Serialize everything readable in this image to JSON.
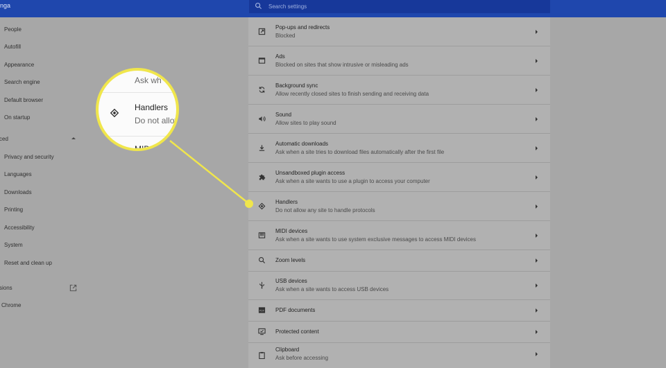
{
  "header": {
    "app_title": "nga",
    "search_placeholder": "Search settings"
  },
  "sidebar": {
    "items": [
      {
        "label": "People"
      },
      {
        "label": "Autofill"
      },
      {
        "label": "Appearance"
      },
      {
        "label": "Search engine"
      },
      {
        "label": "Default browser"
      },
      {
        "label": "On startup"
      }
    ],
    "advanced_label": "ced",
    "advanced_items": [
      {
        "label": "Privacy and security"
      },
      {
        "label": "Languages"
      },
      {
        "label": "Downloads"
      },
      {
        "label": "Printing"
      },
      {
        "label": "Accessibility"
      },
      {
        "label": "System"
      },
      {
        "label": "Reset and clean up"
      }
    ],
    "extensions_label": "sions",
    "about_label": "Chrome"
  },
  "settings_rows": [
    {
      "icon": "popup-redirect-icon",
      "title": "Pop-ups and redirects",
      "subtitle": "Blocked"
    },
    {
      "icon": "ads-icon",
      "title": "Ads",
      "subtitle": "Blocked on sites that show intrusive or misleading ads"
    },
    {
      "icon": "sync-icon",
      "title": "Background sync",
      "subtitle": "Allow recently closed sites to finish sending and receiving data"
    },
    {
      "icon": "sound-icon",
      "title": "Sound",
      "subtitle": "Allow sites to play sound"
    },
    {
      "icon": "download-icon",
      "title": "Automatic downloads",
      "subtitle": "Ask when a site tries to download files automatically after the first file"
    },
    {
      "icon": "puzzle-icon",
      "title": "Unsandboxed plugin access",
      "subtitle": "Ask when a site wants to use a plugin to access your computer"
    },
    {
      "icon": "handlers-icon",
      "title": "Handlers",
      "subtitle": "Do not allow any site to handle protocols"
    },
    {
      "icon": "midi-icon",
      "title": "MIDI devices",
      "subtitle": "Ask when a site wants to use system exclusive messages to access MIDI devices"
    },
    {
      "icon": "zoom-icon",
      "title": "Zoom levels",
      "subtitle": ""
    },
    {
      "icon": "usb-icon",
      "title": "USB devices",
      "subtitle": "Ask when a site wants to access USB devices"
    },
    {
      "icon": "pdf-icon",
      "title": "PDF documents",
      "subtitle": ""
    },
    {
      "icon": "protected-content-icon",
      "title": "Protected content",
      "subtitle": ""
    },
    {
      "icon": "clipboard-icon",
      "title": "Clipboard",
      "subtitle": "Ask before accessing"
    }
  ],
  "callout": {
    "top_text": "Ask wh",
    "title": "Handlers",
    "subtitle": "Do not allov",
    "bottom_text": "MIDI d",
    "ring_color": "#f0e64c"
  }
}
